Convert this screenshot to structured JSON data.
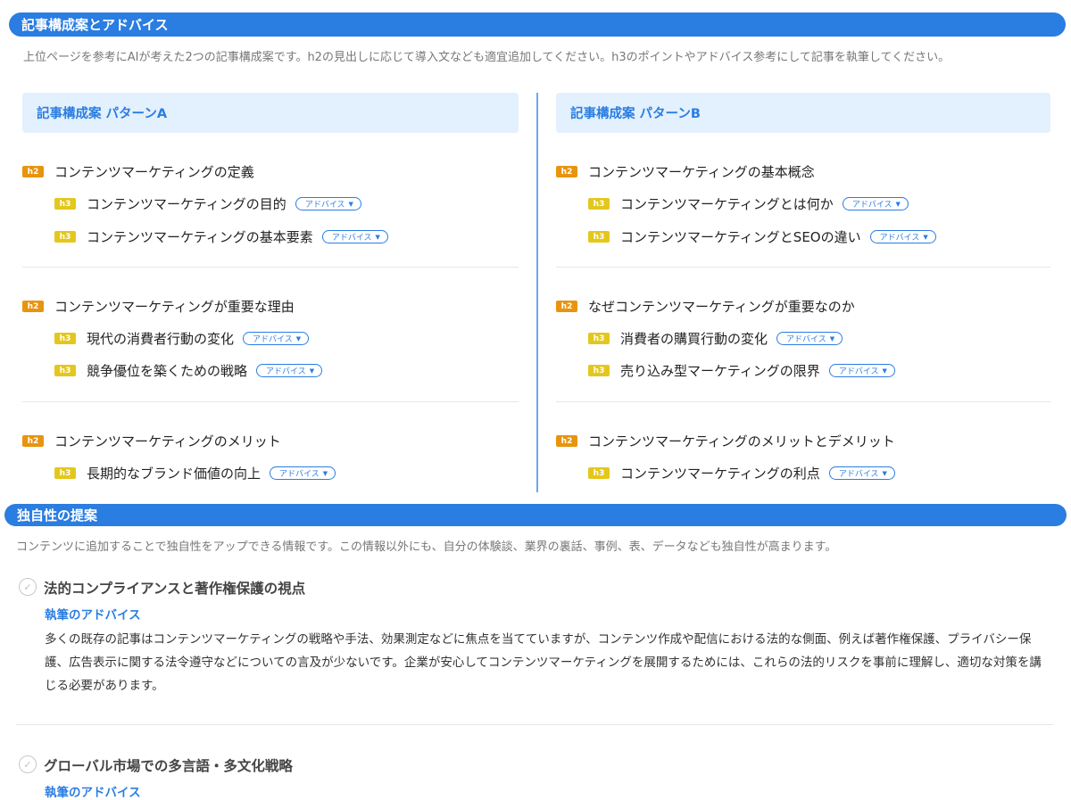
{
  "section1": {
    "title": "記事構成案とアドバイス",
    "description": "上位ページを参考にAIが考えた2つの記事構成案です。h2の見出しに応じて導入文なども適宜追加してください。h3のポイントやアドバイス参考にして記事を執筆してください。"
  },
  "advice_label": "アドバイス",
  "tag_h2": "h2",
  "tag_h3": "h3",
  "patternA": {
    "header": "記事構成案 パターンA",
    "groups": [
      {
        "h2": "コンテンツマーケティングの定義",
        "h3": [
          "コンテンツマーケティングの目的",
          "コンテンツマーケティングの基本要素"
        ]
      },
      {
        "h2": "コンテンツマーケティングが重要な理由",
        "h3": [
          "現代の消費者行動の変化",
          "競争優位を築くための戦略"
        ]
      },
      {
        "h2": "コンテンツマーケティングのメリット",
        "h3": [
          "長期的なブランド価値の向上"
        ]
      }
    ]
  },
  "patternB": {
    "header": "記事構成案 パターンB",
    "groups": [
      {
        "h2": "コンテンツマーケティングの基本概念",
        "h3": [
          "コンテンツマーケティングとは何か",
          "コンテンツマーケティングとSEOの違い"
        ]
      },
      {
        "h2": "なぜコンテンツマーケティングが重要なのか",
        "h3": [
          "消費者の購買行動の変化",
          "売り込み型マーケティングの限界"
        ]
      },
      {
        "h2": "コンテンツマーケティングのメリットとデメリット",
        "h3": [
          "コンテンツマーケティングの利点"
        ]
      }
    ]
  },
  "section2": {
    "title": "独自性の提案",
    "description": "コンテンツに追加することで独自性をアップできる情報です。この情報以外にも、自分の体験談、業界の裏話、事例、表、データなども独自性が高まります。",
    "proposals": [
      {
        "title": "法的コンプライアンスと著作権保護の視点",
        "subtitle": "執筆のアドバイス",
        "body": "多くの既存の記事はコンテンツマーケティングの戦略や手法、効果測定などに焦点を当てていますが、コンテンツ作成や配信における法的な側面、例えば著作権保護、プライバシー保護、広告表示に関する法令遵守などについての言及が少ないです。企業が安心してコンテンツマーケティングを展開するためには、これらの法的リスクを事前に理解し、適切な対策を講じる必要があります。"
      },
      {
        "title": "グローバル市場での多言語・多文化戦略",
        "subtitle": "執筆のアドバイス"
      }
    ]
  }
}
